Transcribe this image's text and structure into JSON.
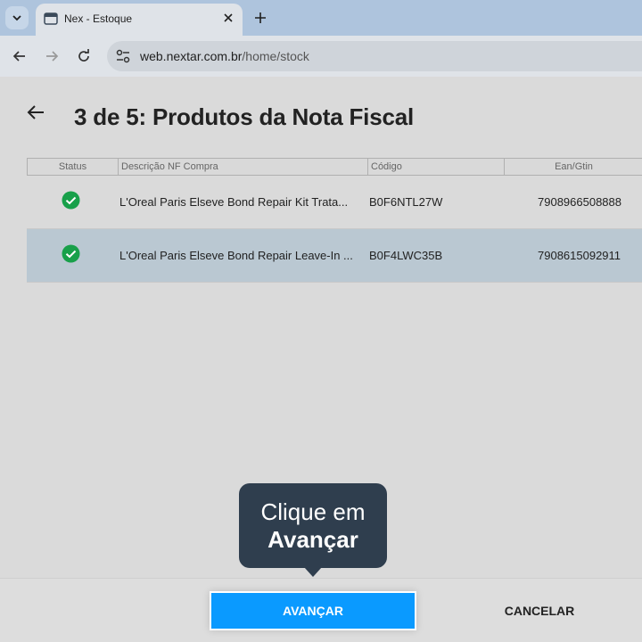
{
  "browser": {
    "tab_title": "Nex - Estoque",
    "url_host": "web.nextar.com.br",
    "url_path": "/home/stock"
  },
  "page": {
    "title": "3 de 5: Produtos da Nota Fiscal"
  },
  "table": {
    "headers": {
      "status": "Status",
      "description": "Descrição NF Compra",
      "code": "Código",
      "ean": "Ean/Gtin"
    },
    "rows": [
      {
        "status": "ok",
        "description": "L'Oreal Paris Elseve Bond Repair Kit Trata...",
        "code": "B0F6NTL27W",
        "ean": "7908966508888",
        "selected": false
      },
      {
        "status": "ok",
        "description": "L'Oreal Paris Elseve Bond Repair Leave-In ...",
        "code": "B0F4LWC35B",
        "ean": "7908615092911",
        "selected": true
      }
    ]
  },
  "tooltip": {
    "line1": "Clique em",
    "line2": "Avançar"
  },
  "footer": {
    "primary_label": "AVANÇAR",
    "secondary_label": "CANCELAR"
  },
  "colors": {
    "primary": "#0a9aff",
    "success": "#18a04a",
    "tooltip_bg": "#2f3e4e",
    "selected_row": "#bac8d2"
  }
}
